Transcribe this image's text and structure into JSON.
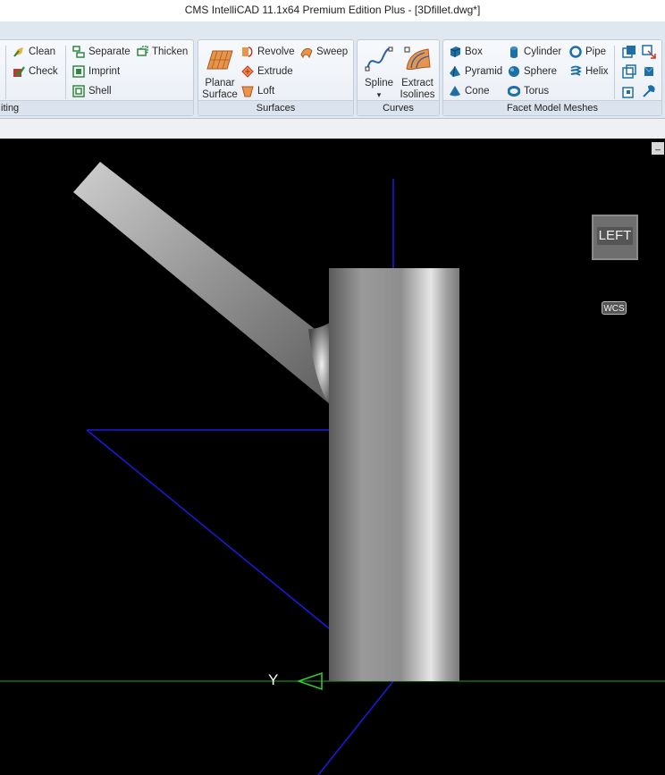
{
  "window": {
    "title": "CMS IntelliCAD 11.1x64 Premium Edition Plus  - [3Dfillet.dwg*]"
  },
  "ribbon": {
    "editing": {
      "label": "iting",
      "items": {
        "clean": "Clean",
        "check": "Check",
        "separate": "Separate",
        "imprint": "Imprint",
        "shell": "Shell",
        "thicken": "Thicken"
      }
    },
    "surfaces": {
      "label": "Surfaces",
      "planar_line1": "Planar",
      "planar_line2": "Surface",
      "items": {
        "revolve": "Revolve",
        "extrude": "Extrude",
        "loft": "Loft",
        "sweep": "Sweep"
      }
    },
    "curves": {
      "label": "Curves",
      "spline": "Spline",
      "spline_arrow": "▾",
      "extract_line1": "Extract",
      "extract_line2": "Isolines"
    },
    "meshes": {
      "label": "Facet Model Meshes",
      "items": {
        "box": "Box",
        "pyramid": "Pyramid",
        "cone": "Cone",
        "cylinder": "Cylinder",
        "sphere": "Sphere",
        "torus": "Torus",
        "pipe": "Pipe",
        "helix": "Helix"
      }
    }
  },
  "viewport": {
    "view_cube_label": "LEFT",
    "ucs_label": "WCS",
    "axis_label": "Y",
    "minimize_symbol": "_"
  }
}
